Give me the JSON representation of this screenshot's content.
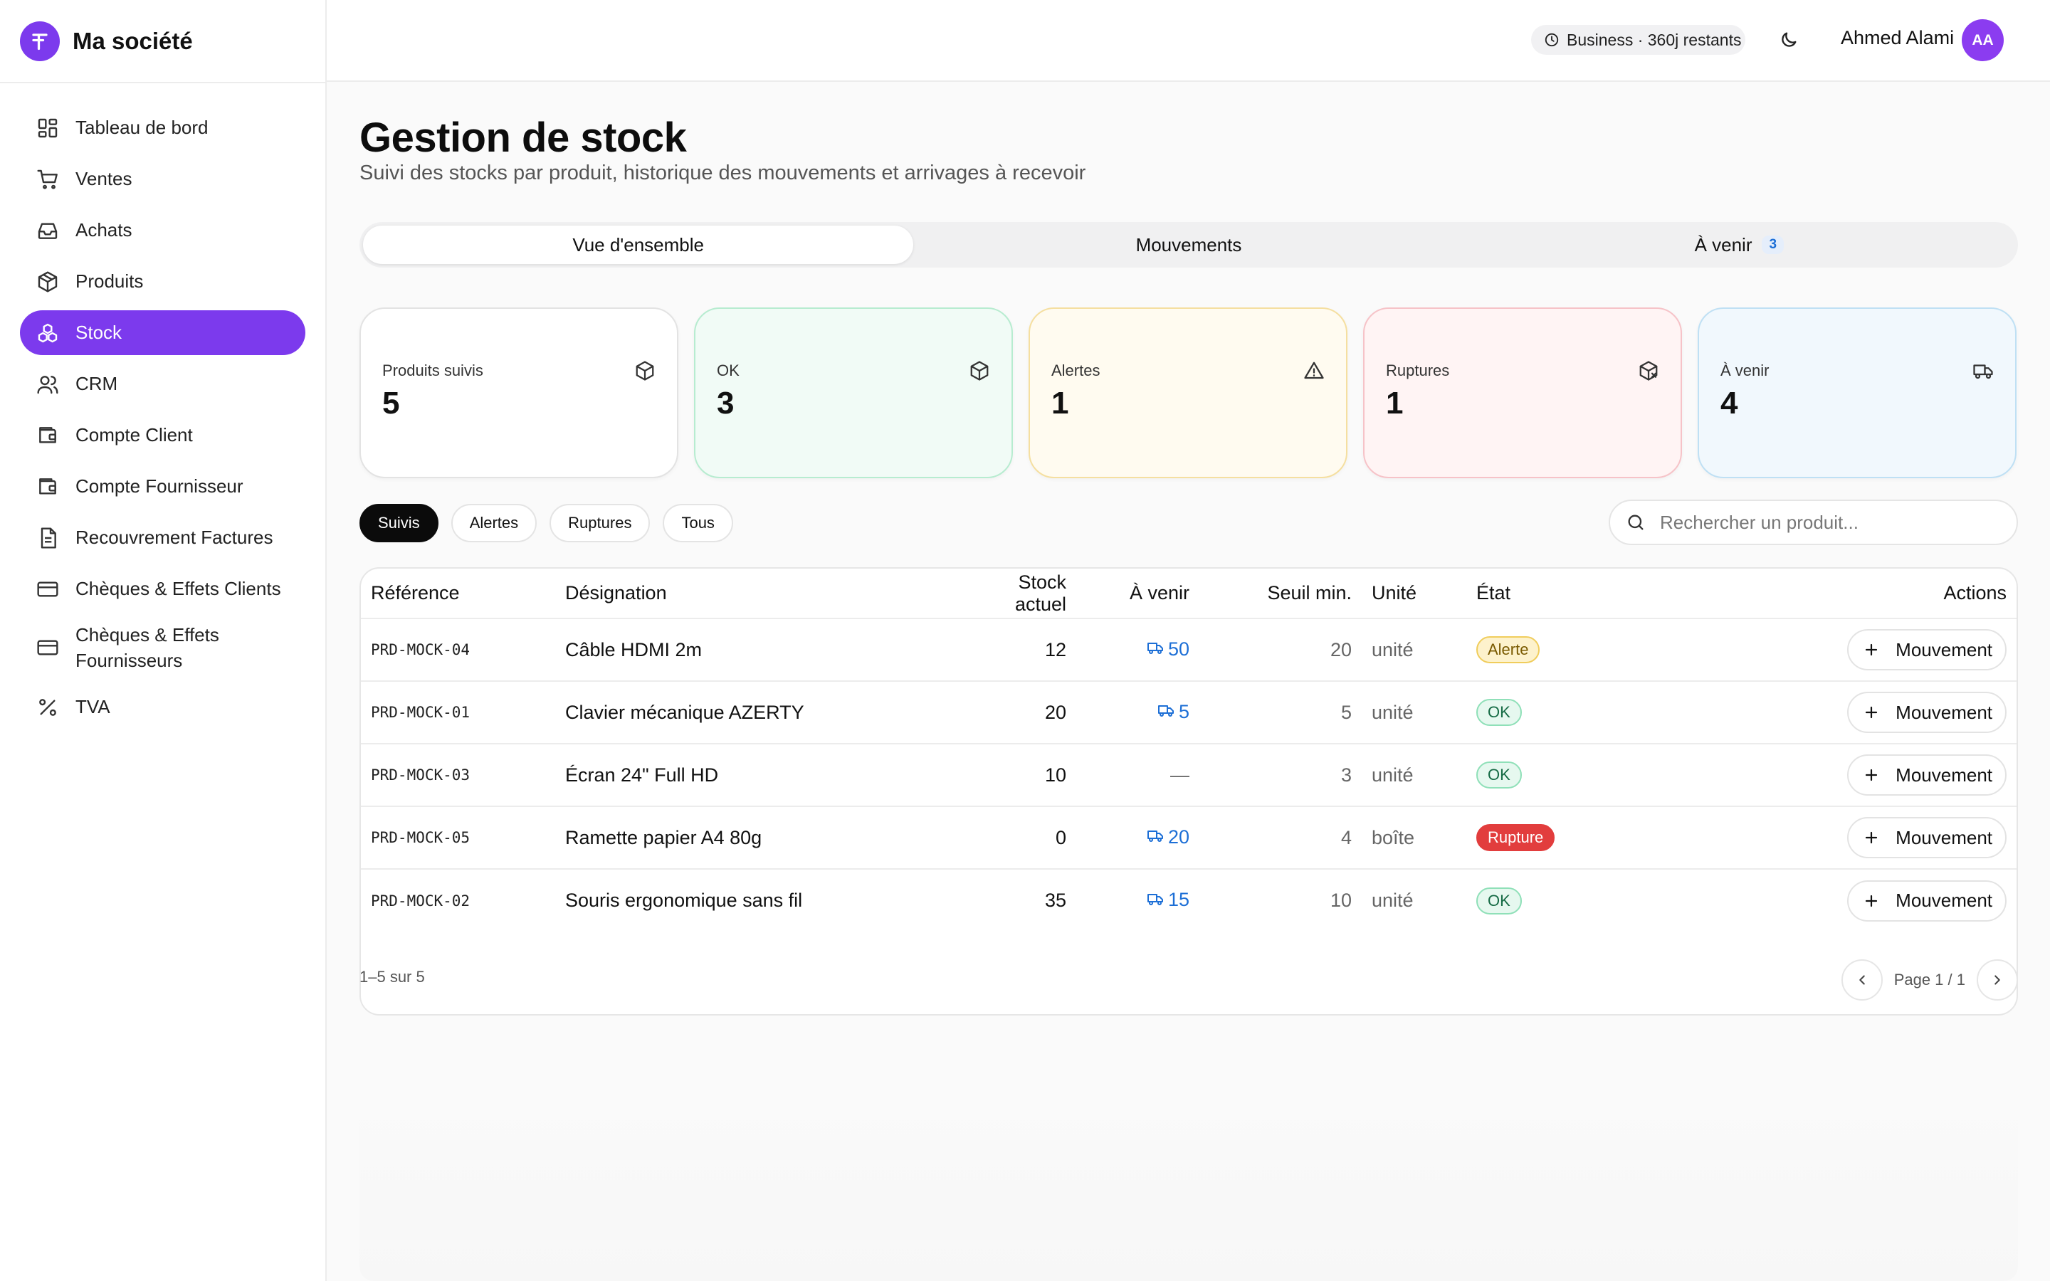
{
  "brand": {
    "name": "Ma société"
  },
  "sidebar": {
    "items": [
      {
        "label": "Tableau de bord",
        "icon": "dashboard-icon"
      },
      {
        "label": "Ventes",
        "icon": "cart-icon"
      },
      {
        "label": "Achats",
        "icon": "inbox-icon"
      },
      {
        "label": "Produits",
        "icon": "package-icon"
      },
      {
        "label": "Stock",
        "icon": "boxes-icon",
        "active": true
      },
      {
        "label": "CRM",
        "icon": "users-icon"
      },
      {
        "label": "Compte Client",
        "icon": "wallet-icon"
      },
      {
        "label": "Compte Fournisseur",
        "icon": "wallet-icon"
      },
      {
        "label": "Recouvrement Factures",
        "icon": "document-icon"
      },
      {
        "label": "Chèques & Effets Clients",
        "icon": "credit-card-icon"
      },
      {
        "label": "Chèques & Effets Fournisseurs",
        "icon": "credit-card-icon"
      },
      {
        "label": "TVA",
        "icon": "percent-icon"
      }
    ]
  },
  "header": {
    "plan": "Business · 360j restants",
    "user_name": "Ahmed Alami",
    "user_initials": "AA"
  },
  "page": {
    "title": "Gestion de stock",
    "subtitle": "Suivi des stocks par produit, historique des mouvements et arrivages à recevoir"
  },
  "tabs": [
    {
      "label": "Vue d'ensemble",
      "active": true
    },
    {
      "label": "Mouvements"
    },
    {
      "label": "À venir",
      "count": "3"
    }
  ],
  "cards": [
    {
      "label": "Produits suivis",
      "value": "5",
      "icon": "package-icon"
    },
    {
      "label": "OK",
      "value": "3",
      "icon": "package-check-icon"
    },
    {
      "label": "Alertes",
      "value": "1",
      "icon": "warning-triangle-icon"
    },
    {
      "label": "Ruptures",
      "value": "1",
      "icon": "package-x-icon"
    },
    {
      "label": "À venir",
      "value": "4",
      "icon": "truck-icon"
    }
  ],
  "filters": [
    "Suivis",
    "Alertes",
    "Ruptures",
    "Tous"
  ],
  "search": {
    "placeholder": "Rechercher un produit..."
  },
  "table": {
    "columns": [
      "Référence",
      "Désignation",
      "Stock actuel",
      "À venir",
      "Seuil min.",
      "Unité",
      "État",
      "Actions"
    ],
    "rows": [
      {
        "ref": "PRD-MOCK-04",
        "name": "Câble HDMI 2m",
        "stock": "12",
        "incoming": "50",
        "min": "20",
        "unit": "unité",
        "status": "Alerte",
        "status_type": "alert",
        "action": "Mouvement"
      },
      {
        "ref": "PRD-MOCK-01",
        "name": "Clavier mécanique AZERTY",
        "stock": "20",
        "incoming": "5",
        "min": "5",
        "unit": "unité",
        "status": "OK",
        "status_type": "ok",
        "action": "Mouvement"
      },
      {
        "ref": "PRD-MOCK-03",
        "name": "Écran 24\" Full HD",
        "stock": "10",
        "incoming": "—",
        "min": "3",
        "unit": "unité",
        "status": "OK",
        "status_type": "ok",
        "action": "Mouvement"
      },
      {
        "ref": "PRD-MOCK-05",
        "name": "Ramette papier A4 80g",
        "stock": "0",
        "incoming": "20",
        "min": "4",
        "unit": "boîte",
        "status": "Rupture",
        "status_type": "rupture",
        "action": "Mouvement"
      },
      {
        "ref": "PRD-MOCK-02",
        "name": "Souris ergonomique sans fil",
        "stock": "35",
        "incoming": "15",
        "min": "10",
        "unit": "unité",
        "status": "OK",
        "status_type": "ok",
        "action": "Mouvement"
      }
    ]
  },
  "pagination": {
    "info": "1–5 sur 5",
    "page": "Page 1 / 1"
  },
  "colors": {
    "accent": "#7c3aed",
    "incoming": "#1d6fd6",
    "rupture": "#e23d3d"
  }
}
